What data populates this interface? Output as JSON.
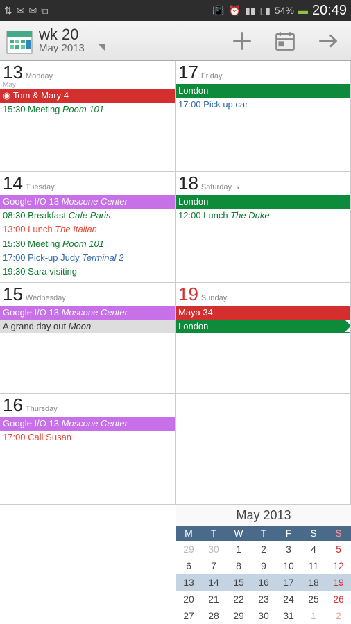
{
  "status": {
    "battery": "54%",
    "time": "20:49"
  },
  "header": {
    "week": "wk 20",
    "month": "May 2013"
  },
  "days": [
    {
      "num": "13",
      "name": "Monday",
      "sub": "May",
      "red": false,
      "moon": "",
      "events": [
        {
          "cls": "bg-red",
          "pre": "◉ ",
          "text": "Tom & Mary 4",
          "loc": ""
        },
        {
          "cls": "txt-green",
          "pre": "15:30 ",
          "text": "Meeting",
          "loc": "Room 101"
        }
      ]
    },
    {
      "num": "17",
      "name": "Friday",
      "sub": "",
      "red": false,
      "moon": "",
      "events": [
        {
          "cls": "bg-green",
          "pre": "",
          "text": "London",
          "loc": ""
        },
        {
          "cls": "txt-blue",
          "pre": "17:00 ",
          "text": "Pick up car",
          "loc": ""
        }
      ]
    },
    {
      "num": "14",
      "name": "Tuesday",
      "sub": "",
      "red": false,
      "moon": "",
      "events": [
        {
          "cls": "bg-purple",
          "pre": "",
          "text": "Google I/O 13",
          "loc": "Moscone Center"
        },
        {
          "cls": "txt-green",
          "pre": "08:30 ",
          "text": "Breakfast",
          "loc": "Cafe Paris"
        },
        {
          "cls": "txt-red",
          "pre": "13:00 ",
          "text": "Lunch",
          "loc": "The Italian"
        },
        {
          "cls": "txt-green",
          "pre": "15:30 ",
          "text": "Meeting",
          "loc": "Room 101"
        },
        {
          "cls": "txt-blue",
          "pre": "17:00 ",
          "text": "Pick-up Judy",
          "loc": "Terminal 2"
        },
        {
          "cls": "txt-green",
          "pre": "19:30 ",
          "text": "Sara visiting",
          "loc": ""
        }
      ]
    },
    {
      "num": "18",
      "name": "Saturday",
      "sub": "",
      "red": false,
      "moon": "◑",
      "events": [
        {
          "cls": "bg-green",
          "pre": "",
          "text": "London",
          "loc": ""
        },
        {
          "cls": "txt-green",
          "pre": "12:00 ",
          "text": "Lunch",
          "loc": "The Duke"
        }
      ]
    },
    {
      "num": "15",
      "name": "Wednesday",
      "sub": "",
      "red": false,
      "moon": "",
      "events": [
        {
          "cls": "bg-purple",
          "pre": "",
          "text": "Google I/O 13",
          "loc": "Moscone Center"
        },
        {
          "cls": "bg-gray",
          "pre": "",
          "text": "A grand day out",
          "loc": "Moon"
        }
      ]
    },
    {
      "num": "19",
      "name": "Sunday",
      "sub": "",
      "red": true,
      "moon": "",
      "events": [
        {
          "cls": "bg-red",
          "pre": "",
          "text": "Maya 34",
          "loc": ""
        },
        {
          "cls": "bg-green arrow-cont",
          "pre": "",
          "text": "London",
          "loc": ""
        }
      ]
    },
    {
      "num": "16",
      "name": "Thursday",
      "sub": "",
      "red": false,
      "moon": "",
      "events": [
        {
          "cls": "bg-purple",
          "pre": "",
          "text": "Google I/O 13",
          "loc": "Moscone Center"
        },
        {
          "cls": "txt-red",
          "pre": "17:00 ",
          "text": "Call Susan",
          "loc": ""
        }
      ]
    },
    {
      "num": "",
      "name": "",
      "sub": "",
      "red": false,
      "moon": "",
      "events": []
    }
  ],
  "miniCal": {
    "title": "May 2013",
    "dow": [
      "M",
      "T",
      "W",
      "T",
      "F",
      "S",
      "S"
    ],
    "rows": [
      {
        "cur": false,
        "cells": [
          {
            "v": "29",
            "o": true
          },
          {
            "v": "30",
            "o": true
          },
          {
            "v": "1"
          },
          {
            "v": "2"
          },
          {
            "v": "3"
          },
          {
            "v": "4"
          },
          {
            "v": "5",
            "s": true
          }
        ]
      },
      {
        "cur": false,
        "cells": [
          {
            "v": "6"
          },
          {
            "v": "7"
          },
          {
            "v": "8"
          },
          {
            "v": "9"
          },
          {
            "v": "10"
          },
          {
            "v": "11"
          },
          {
            "v": "12",
            "s": true
          }
        ]
      },
      {
        "cur": true,
        "cells": [
          {
            "v": "13"
          },
          {
            "v": "14"
          },
          {
            "v": "15"
          },
          {
            "v": "16"
          },
          {
            "v": "17"
          },
          {
            "v": "18"
          },
          {
            "v": "19",
            "s": true
          }
        ]
      },
      {
        "cur": false,
        "cells": [
          {
            "v": "20"
          },
          {
            "v": "21"
          },
          {
            "v": "22"
          },
          {
            "v": "23"
          },
          {
            "v": "24"
          },
          {
            "v": "25"
          },
          {
            "v": "26",
            "s": true
          }
        ]
      },
      {
        "cur": false,
        "cells": [
          {
            "v": "27"
          },
          {
            "v": "28"
          },
          {
            "v": "29"
          },
          {
            "v": "30"
          },
          {
            "v": "31"
          },
          {
            "v": "1",
            "o": true
          },
          {
            "v": "2",
            "o": true,
            "s": true
          }
        ]
      }
    ]
  }
}
